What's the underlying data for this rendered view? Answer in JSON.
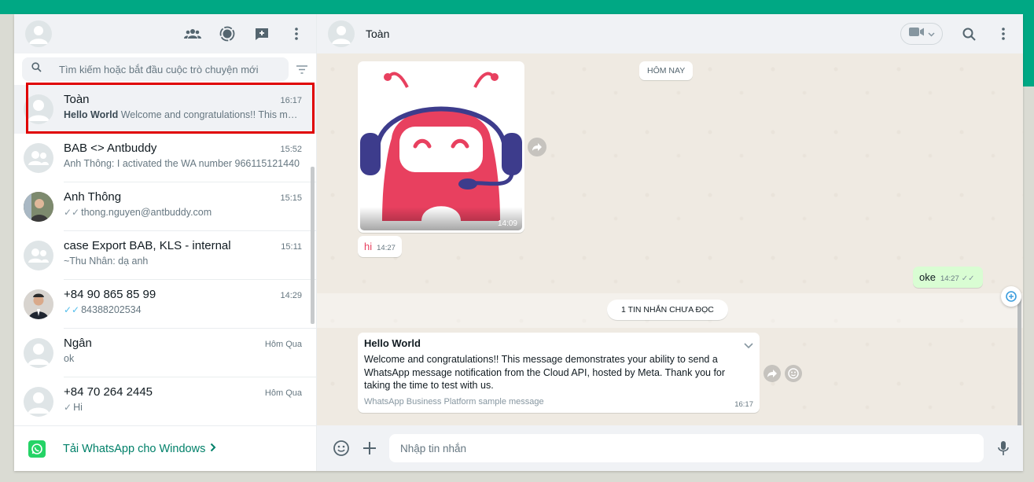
{
  "colors": {
    "accent": "#00a884",
    "highlight": "#e00000",
    "bubble_out": "#d9fdd3"
  },
  "sidebar": {
    "header_icons": [
      "communities-icon",
      "status-icon",
      "new-chat-icon",
      "menu-icon"
    ],
    "search": {
      "placeholder": "Tìm kiếm hoặc bắt đầu cuộc trò chuyện mới"
    },
    "chats": [
      {
        "name": "Toàn",
        "time": "16:17",
        "preview_bold": "Hello World",
        "preview": "Welcome and congratulations!! This mes...",
        "active": true
      },
      {
        "name": "BAB <> Antbuddy",
        "time": "15:52",
        "preview": "Anh Thông: I activated the WA number 966115121440"
      },
      {
        "name": "Anh Thông",
        "time": "15:15",
        "tick": "✓✓",
        "preview": "thong.nguyen@antbuddy.com"
      },
      {
        "name": "case Export BAB, KLS - internal",
        "time": "15:11",
        "preview": "~Thu Nhân: dạ anh"
      },
      {
        "name": "+84 90 865 85 99",
        "time": "14:29",
        "tick": "✓✓",
        "preview": "84388202534"
      },
      {
        "name": "Ngân",
        "time": "Hôm Qua",
        "preview": "ok"
      },
      {
        "name": "+84 70 264 2445",
        "time": "Hôm Qua",
        "tick": "✓",
        "preview": "Hi"
      }
    ],
    "footer_link": "Tải WhatsApp cho Windows"
  },
  "main": {
    "contact_name": "Toàn",
    "date_label": "HÔM NAY",
    "image_time": "14:09",
    "msg_hi": {
      "text": "hi",
      "time": "14:27"
    },
    "msg_oke": {
      "text": "oke",
      "time": "14:27",
      "tick": "✓✓"
    },
    "unread_label": "1 TIN NHẮN CHƯA ĐỌC",
    "template": {
      "header": "Hello World",
      "body": "Welcome and congratulations!! This message demonstrates your ability to send a WhatsApp message notification from the Cloud API, hosted by Meta. Thank you for taking the time to test with us.",
      "footer": "WhatsApp Business Platform sample message",
      "time": "16:17"
    },
    "composer_placeholder": "Nhập tin nhắn"
  }
}
